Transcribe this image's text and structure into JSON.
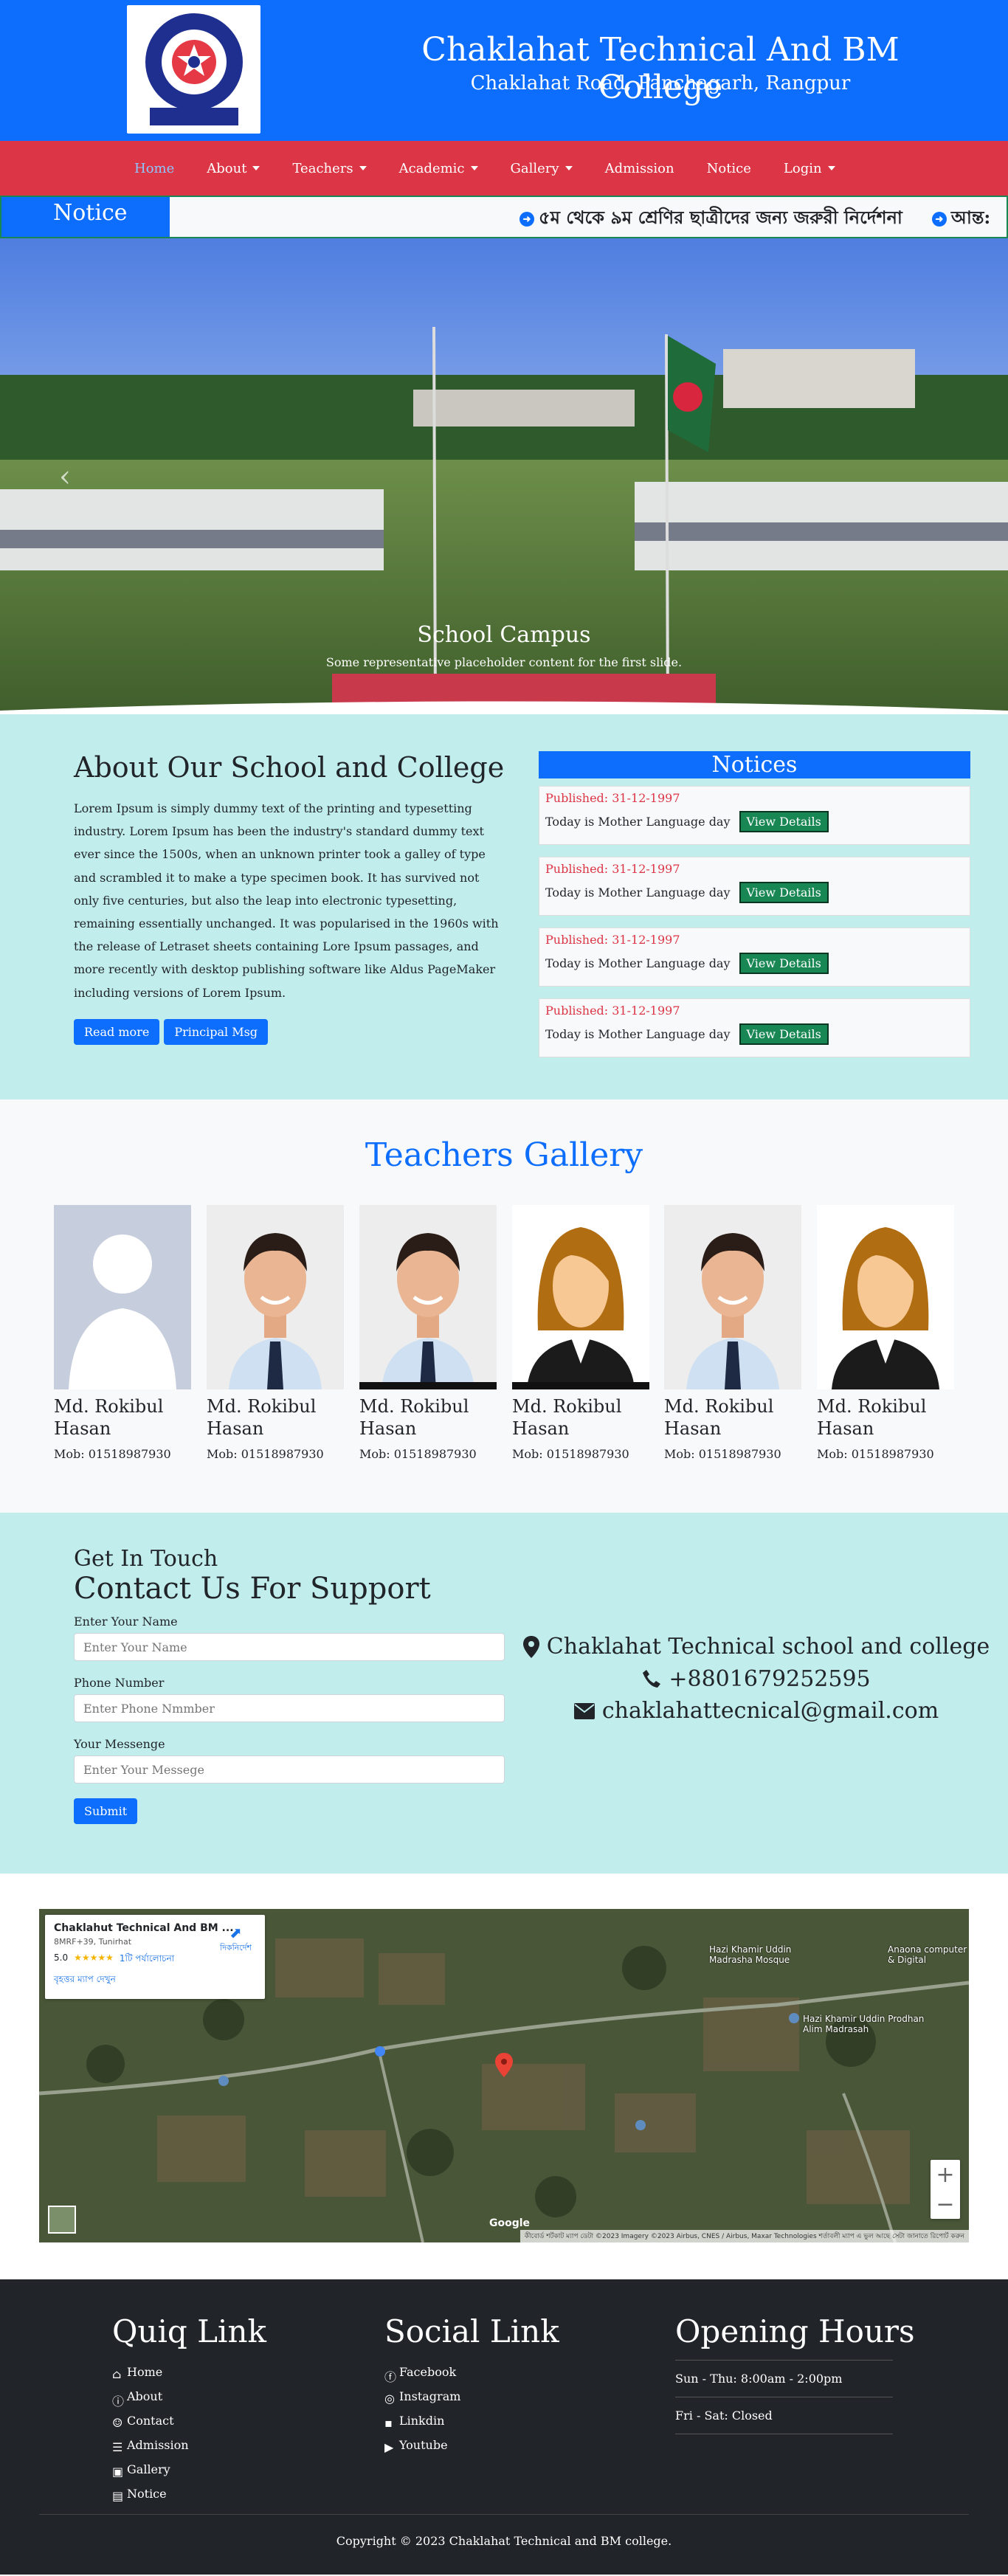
{
  "header": {
    "logo_alt": "college-seal",
    "logo_text_top": "চাকলাহাট টেকনিক্যাল এন্ড বিজনেস ম্যানেজমেন্ট কলেজ",
    "logo_text_bottom": "স্থাপিত ঃ ২০০০ ইং",
    "title": "Chaklahat Technical And BM College",
    "subtitle": "Chaklahat Road, Panchagarh, Rangpur"
  },
  "nav": {
    "items": [
      {
        "label": "Home",
        "active": true,
        "dropdown": false
      },
      {
        "label": "About",
        "dropdown": true
      },
      {
        "label": "Teachers",
        "dropdown": true
      },
      {
        "label": "Academic",
        "dropdown": true
      },
      {
        "label": "Gallery",
        "dropdown": true
      },
      {
        "label": "Admission",
        "dropdown": false
      },
      {
        "label": "Notice",
        "dropdown": false
      },
      {
        "label": "Login",
        "dropdown": true
      }
    ]
  },
  "notice_bar": {
    "label": "Notice",
    "items": [
      "৫ম থেকে ৯ম শ্রেণির ছাত্রীদের জন্য জরুরী নির্দেশনা",
      "আন্ত:"
    ]
  },
  "hero": {
    "caption_title": "School Campus",
    "caption_text": "Some representative placeholder content for the first slide.",
    "prev_icon": "chevron-left-icon"
  },
  "about": {
    "title": "About Our School and College",
    "body": "Lorem Ipsum is simply dummy text of the printing and typesetting industry. Lorem Ipsum has been the industry's standard dummy text ever since the 1500s, when an unknown printer took a galley of type and scrambled it to make a type specimen book. It has survived not only five centuries, but also the leap into electronic typesetting, remaining essentially unchanged. It was popularised in the 1960s with the release of Letraset sheets containing Lore Ipsum passages, and more recently with desktop publishing software like Aldus PageMaker including versions of Lorem Ipsum.",
    "read_more": "Read more",
    "principal_msg": "Principal Msg"
  },
  "notices": {
    "title": "Notices",
    "items": [
      {
        "date": "Published: 31-12-1997",
        "text": "Today is Mother Language day",
        "button": "View Details"
      },
      {
        "date": "Published: 31-12-1997",
        "text": "Today is Mother Language day",
        "button": "View Details"
      },
      {
        "date": "Published: 31-12-1997",
        "text": "Today is Mother Language day",
        "button": "View Details"
      },
      {
        "date": "Published: 31-12-1997",
        "text": "Today is Mother Language day",
        "button": "View Details"
      }
    ]
  },
  "teachers": {
    "title": "Teachers Gallery",
    "items": [
      {
        "name": "Md. Rokibul Hasan",
        "mob": "Mob: 01518987930",
        "photo": "silhouette"
      },
      {
        "name": "Md. Rokibul Hasan",
        "mob": "Mob: 01518987930",
        "photo": "man"
      },
      {
        "name": "Md. Rokibul Hasan",
        "mob": "Mob: 01518987930",
        "photo": "man"
      },
      {
        "name": "Md. Rokibul Hasan",
        "mob": "Mob: 01518987930",
        "photo": "woman"
      },
      {
        "name": "Md. Rokibul Hasan",
        "mob": "Mob: 01518987930",
        "photo": "man"
      },
      {
        "name": "Md. Rokibul Hasan",
        "mob": "Mob: 01518987930",
        "photo": "woman"
      }
    ]
  },
  "contact": {
    "kicker": "Get In Touch",
    "title": "Contact Us For Support",
    "name_label": "Enter Your Name",
    "name_placeholder": "Enter Your Name",
    "phone_label": "Phone Number",
    "phone_placeholder": "Enter Phone Nmmber",
    "message_label": "Your Messenge",
    "message_placeholder": "Enter Your Messege",
    "submit": "Submit",
    "address": "Chaklahat Technical school and college",
    "phone": "+8801679252595",
    "email": "chaklahattecnical@gmail.com"
  },
  "map": {
    "place_title": "Chaklahut Technical And BM ...",
    "place_code": "8MRF+39, Tunirhat",
    "rating": "5.0",
    "stars": "★★★★★",
    "reviews": "1টি পর্যালোচনা",
    "larger_map": "বৃহত্তর ম্যাপ দেখুন",
    "directions": "দিকনির্দেশ",
    "label_1": "Hazi Khamir Uddin Madrasha Mosque",
    "label_2": "Hazi Khamir Uddin Prodhan Alim Madrasah",
    "label_3": "Anaona computer & Digital",
    "attribution": "কীবোর্ড শর্টকাট   ম্যাপ ডেটা ©2023 Imagery ©2023 Airbus, CNES / Airbus, Maxar Technologies   শর্তাবলী   ম্যাপ এ ভুল আছে সেটা জানাতে রিপোর্ট করুন",
    "google": "Google"
  },
  "footer": {
    "quick_title": "Quiq Link",
    "quick_links": [
      "Home",
      "About",
      "Contact",
      "Admission",
      "Gallery",
      "Notice"
    ],
    "social_title": "Social Link",
    "social_links": [
      "Facebook",
      "Instagram",
      "Linkdin",
      "Youtube"
    ],
    "hours_title": "Opening Hours",
    "hours": [
      "Sun - Thu: 8:00am - 2:00pm",
      "Fri - Sat: Closed"
    ],
    "copyright": "Copyright © 2023 Chaklahat Technical and BM college."
  },
  "colors": {
    "primary": "#0d6efd",
    "nav_red": "#dc3545",
    "teal_bg": "#c1eded",
    "notice_green": "#198754",
    "footer_bg": "#212529"
  }
}
